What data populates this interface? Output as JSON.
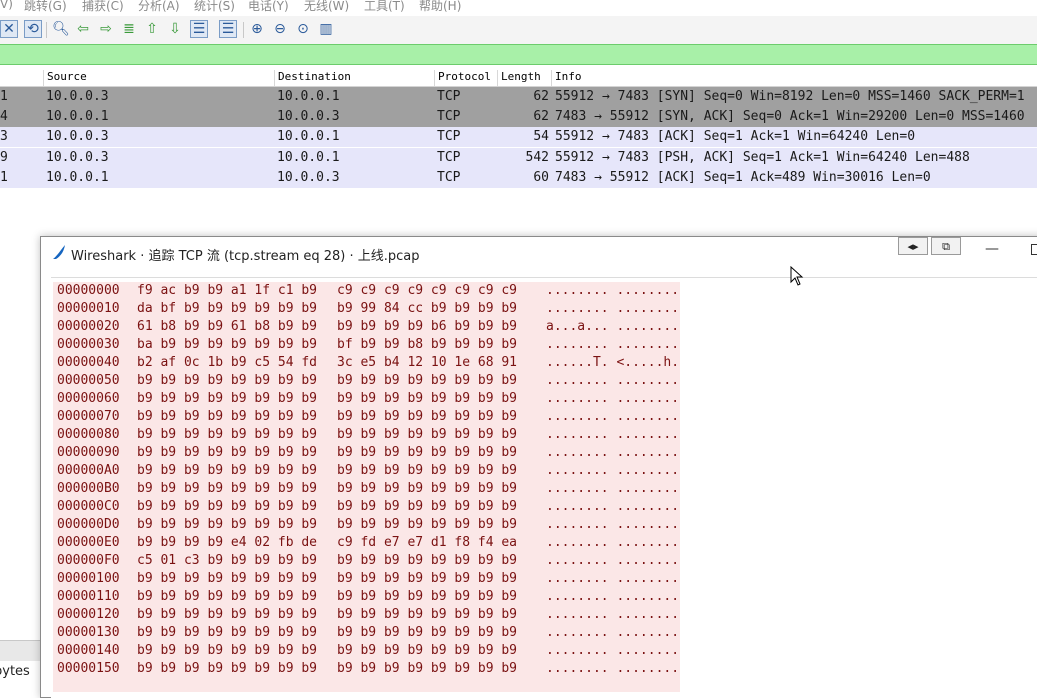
{
  "menu": [
    "V)",
    "跳转(G)",
    "捕获(C)",
    "分析(A)",
    "统计(S)",
    "电话(Y)",
    "无线(W)",
    "工具(T)",
    "帮助(H)"
  ],
  "toolbar": {
    "icons": [
      "close-capture-icon",
      "reload-file-icon",
      "find-icon",
      "go-back-icon",
      "go-forward-icon",
      "go-to-packet-icon",
      "go-first-icon",
      "go-last-icon",
      "auto-scroll-icon",
      "colorize-icon",
      "zoom-in-icon",
      "zoom-out-icon",
      "normal-size-icon",
      "resize-columns-icon"
    ]
  },
  "packet_list": {
    "columns": [
      "Source",
      "Destination",
      "Protocol",
      "Length",
      "Info"
    ],
    "rows": [
      {
        "num": "1",
        "src": "10.0.0.3",
        "dst": "10.0.0.1",
        "proto": "TCP",
        "len": "62",
        "info": "55912 → 7483 [SYN] Seq=0 Win=8192 Len=0 MSS=1460 SACK_PERM=1",
        "bg": "#a0a0a0"
      },
      {
        "num": "4",
        "src": "10.0.0.1",
        "dst": "10.0.0.3",
        "proto": "TCP",
        "len": "62",
        "info": "7483 → 55912 [SYN, ACK] Seq=0 Ack=1 Win=29200 Len=0 MSS=1460",
        "bg": "#a0a0a0"
      },
      {
        "num": "3",
        "src": "10.0.0.3",
        "dst": "10.0.0.1",
        "proto": "TCP",
        "len": "54",
        "info": "55912 → 7483 [ACK] Seq=1 Ack=1 Win=64240 Len=0",
        "bg": "#e6e6fa"
      },
      {
        "num": "9",
        "src": "10.0.0.3",
        "dst": "10.0.0.1",
        "proto": "TCP",
        "len": "542",
        "info": "55912 → 7483 [PSH, ACK] Seq=1 Ack=1 Win=64240 Len=488",
        "bg": "#e6e6fa"
      },
      {
        "num": "1",
        "src": "10.0.0.1",
        "dst": "10.0.0.3",
        "proto": "TCP",
        "len": "60",
        "info": "7483 → 55912 [ACK] Seq=1 Ack=489 Win=30016 Len=0",
        "bg": "#e6e6fa"
      }
    ]
  },
  "status": {
    "bytes_label": "bytes"
  },
  "dialog": {
    "title": "Wireshark · 追踪 TCP 流 (tcp.stream eq 28) · 上线.pcap",
    "hex_rows": [
      {
        "off": "00000000",
        "b1": "f9 ac b9 b9 a1 1f c1 b9",
        "b2": "c9 c9 c9 c9 c9 c9 c9 c9",
        "asc": "........ ........"
      },
      {
        "off": "00000010",
        "b1": "da bf b9 b9 b9 b9 b9 b9",
        "b2": "b9 99 84 cc b9 b9 b9 b9",
        "asc": "........ ........"
      },
      {
        "off": "00000020",
        "b1": "61 b8 b9 b9 61 b8 b9 b9",
        "b2": "b9 b9 b9 b9 b6 b9 b9 b9",
        "asc": "a...a... ........"
      },
      {
        "off": "00000030",
        "b1": "ba b9 b9 b9 b9 b9 b9 b9",
        "b2": "bf b9 b9 b8 b9 b9 b9 b9",
        "asc": "........ ........"
      },
      {
        "off": "00000040",
        "b1": "b2 af 0c 1b b9 c5 54 fd",
        "b2": "3c e5 b4 12 10 1e 68 91",
        "asc": "......T. <.....h."
      },
      {
        "off": "00000050",
        "b1": "b9 b9 b9 b9 b9 b9 b9 b9",
        "b2": "b9 b9 b9 b9 b9 b9 b9 b9",
        "asc": "........ ........"
      },
      {
        "off": "00000060",
        "b1": "b9 b9 b9 b9 b9 b9 b9 b9",
        "b2": "b9 b9 b9 b9 b9 b9 b9 b9",
        "asc": "........ ........"
      },
      {
        "off": "00000070",
        "b1": "b9 b9 b9 b9 b9 b9 b9 b9",
        "b2": "b9 b9 b9 b9 b9 b9 b9 b9",
        "asc": "........ ........"
      },
      {
        "off": "00000080",
        "b1": "b9 b9 b9 b9 b9 b9 b9 b9",
        "b2": "b9 b9 b9 b9 b9 b9 b9 b9",
        "asc": "........ ........"
      },
      {
        "off": "00000090",
        "b1": "b9 b9 b9 b9 b9 b9 b9 b9",
        "b2": "b9 b9 b9 b9 b9 b9 b9 b9",
        "asc": "........ ........"
      },
      {
        "off": "000000A0",
        "b1": "b9 b9 b9 b9 b9 b9 b9 b9",
        "b2": "b9 b9 b9 b9 b9 b9 b9 b9",
        "asc": "........ ........"
      },
      {
        "off": "000000B0",
        "b1": "b9 b9 b9 b9 b9 b9 b9 b9",
        "b2": "b9 b9 b9 b9 b9 b9 b9 b9",
        "asc": "........ ........"
      },
      {
        "off": "000000C0",
        "b1": "b9 b9 b9 b9 b9 b9 b9 b9",
        "b2": "b9 b9 b9 b9 b9 b9 b9 b9",
        "asc": "........ ........"
      },
      {
        "off": "000000D0",
        "b1": "b9 b9 b9 b9 b9 b9 b9 b9",
        "b2": "b9 b9 b9 b9 b9 b9 b9 b9",
        "asc": "........ ........"
      },
      {
        "off": "000000E0",
        "b1": "b9 b9 b9 b9 e4 02 fb de",
        "b2": "c9 fd e7 e7 d1 f8 f4 ea",
        "asc": "........ ........"
      },
      {
        "off": "000000F0",
        "b1": "c5 01 c3 b9 b9 b9 b9 b9",
        "b2": "b9 b9 b9 b9 b9 b9 b9 b9",
        "asc": "........ ........"
      },
      {
        "off": "00000100",
        "b1": "b9 b9 b9 b9 b9 b9 b9 b9",
        "b2": "b9 b9 b9 b9 b9 b9 b9 b9",
        "asc": "........ ........"
      },
      {
        "off": "00000110",
        "b1": "b9 b9 b9 b9 b9 b9 b9 b9",
        "b2": "b9 b9 b9 b9 b9 b9 b9 b9",
        "asc": "........ ........"
      },
      {
        "off": "00000120",
        "b1": "b9 b9 b9 b9 b9 b9 b9 b9",
        "b2": "b9 b9 b9 b9 b9 b9 b9 b9",
        "asc": "........ ........"
      },
      {
        "off": "00000130",
        "b1": "b9 b9 b9 b9 b9 b9 b9 b9",
        "b2": "b9 b9 b9 b9 b9 b9 b9 b9",
        "asc": "........ ........"
      },
      {
        "off": "00000140",
        "b1": "b9 b9 b9 b9 b9 b9 b9 b9",
        "b2": "b9 b9 b9 b9 b9 b9 b9 b9",
        "asc": "........ ........"
      },
      {
        "off": "00000150",
        "b1": "b9 b9 b9 b9 b9 b9 b9 b9",
        "b2": "b9 b9 b9 b9 b9 b9 b9 b9",
        "asc": "........ ........"
      }
    ]
  }
}
